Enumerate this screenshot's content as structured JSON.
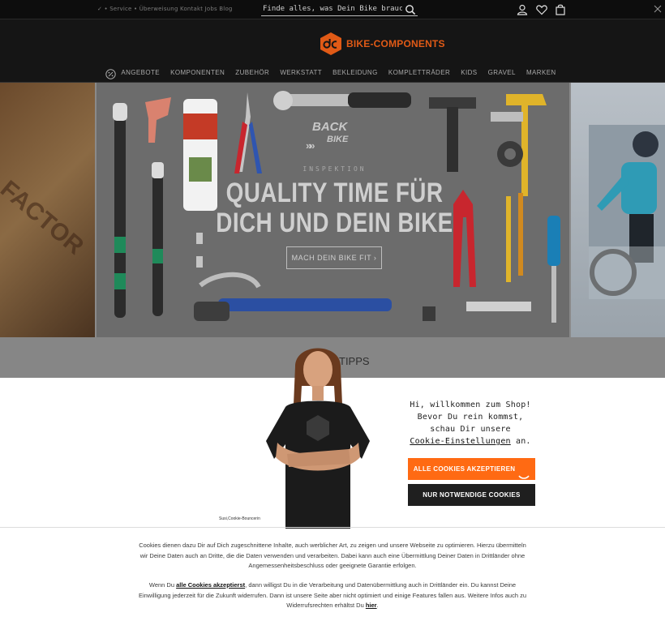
{
  "topbar": {
    "trust_text": "✓ • Service • Überweisung Kontakt Jobs Blog",
    "search_placeholder": "Finde alles, was Dein Bike braucht",
    "icons": [
      "search-icon",
      "user-icon",
      "heart-icon",
      "cart-icon",
      "close-icon"
    ]
  },
  "header": {
    "logo_text": "BIKE-COMPONENTS",
    "brand_color": "#e05a16",
    "nav": [
      "ANGEBOTE",
      "KOMPONENTEN",
      "ZUBEHÖR",
      "WERKSTATT",
      "BEKLEIDUNG",
      "KOMPLETTRÄDER",
      "KIDS",
      "GRAVEL",
      "MARKEN"
    ]
  },
  "hero": {
    "badge_line1": "BACK",
    "badge_line2": "BIKE",
    "badge_chevrons": "»»",
    "kicker": "INSPEKTION",
    "headline_line1": "QUALITY TIME FÜR",
    "headline_line2": "DICH UND DEIN BIKE",
    "cta_label": "MACH DEIN BIKE FIT ›",
    "left_slide_text": "FACTOR"
  },
  "strip": {
    "label": "TIPPS"
  },
  "cookie": {
    "caption": "Susi,Cookie-Bouncerin",
    "greeting_line1": "Hi, willkommen zum Shop!",
    "greeting_line2": "Bevor Du rein kommst,",
    "greeting_line3": "schau Dir unsere",
    "greeting_link": "Cookie-Einstellungen",
    "greeting_end": " an.",
    "accept_label": "ALLE COOKIES AKZEPTIEREN",
    "necessary_label": "NUR NOTWENDIGE COOKIES",
    "accent_color": "#ff6a13",
    "legal_p1": "Cookies dienen dazu Dir auf Dich zugeschnittene Inhalte, auch werblicher Art, zu zeigen und unsere Webseite zu optimieren. Hierzu übermitteln wir Deine Daten auch an Dritte, die die Daten verwenden und verarbeiten. Dabei kann auch eine Übermittlung Deiner Daten in Drittländer ohne Angemessenheitsbeschluss oder geeignete Garantie erfolgen.",
    "legal_p2_pre": "Wenn Du ",
    "legal_p2_link": "alle Cookies akzeptierst",
    "legal_p2_mid": ", dann willigst Du in die Verarbeitung und Datenübermittlung auch in Drittländer ein. Du kannst Deine Einwilligung jederzeit für die Zukunft widerrufen. Dann ist unsere Seite aber nicht optimiert und einige Features fallen aus. Weitere Infos auch zu Widerrufsrechten erhältst Du ",
    "legal_p2_here": "hier",
    "legal_p2_end": "."
  }
}
